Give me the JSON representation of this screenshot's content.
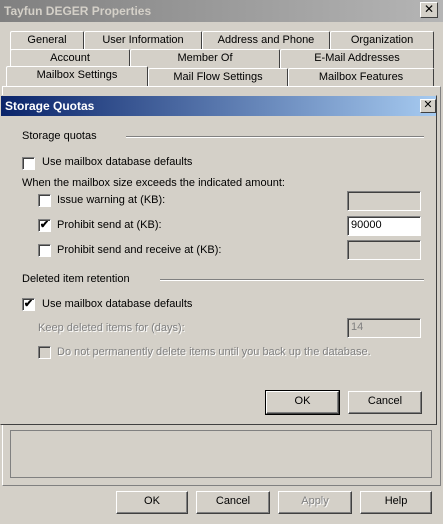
{
  "outer_window": {
    "title": "Tayfun DEGER Properties",
    "close_glyph": "✕",
    "tabs_row1": [
      "General",
      "User Information",
      "Address and Phone",
      "Organization"
    ],
    "tabs_row2": [
      "Account",
      "Member Of",
      "E-Mail Addresses"
    ],
    "tabs_row3": [
      "Mailbox Settings",
      "Mail Flow Settings",
      "Mailbox Features"
    ],
    "buttons": {
      "ok": "OK",
      "cancel": "Cancel",
      "apply": "Apply",
      "help": "Help"
    }
  },
  "dialog": {
    "title": "Storage Quotas",
    "close_glyph": "✕",
    "storage_quotas": {
      "group_label": "Storage quotas",
      "use_defaults_label": "Use mailbox database defaults",
      "use_defaults_checked": false,
      "exceeds_label": "When the mailbox size exceeds the indicated amount:",
      "issue_warning": {
        "label": "Issue warning at (KB):",
        "checked": false,
        "value": ""
      },
      "prohibit_send": {
        "label": "Prohibit send at (KB):",
        "checked": true,
        "value": "90000"
      },
      "prohibit_send_receive": {
        "label": "Prohibit send and receive at (KB):",
        "checked": false,
        "value": ""
      }
    },
    "deleted_item_retention": {
      "group_label": "Deleted item retention",
      "use_defaults_label": "Use mailbox database defaults",
      "use_defaults_checked": true,
      "keep_deleted_label": "Keep deleted items for (days):",
      "keep_deleted_value": "14",
      "do_not_delete_label": "Do not permanently delete items until you back up the database.",
      "do_not_delete_checked": false
    },
    "buttons": {
      "ok": "OK",
      "cancel": "Cancel"
    },
    "check_glyph": "✔"
  }
}
